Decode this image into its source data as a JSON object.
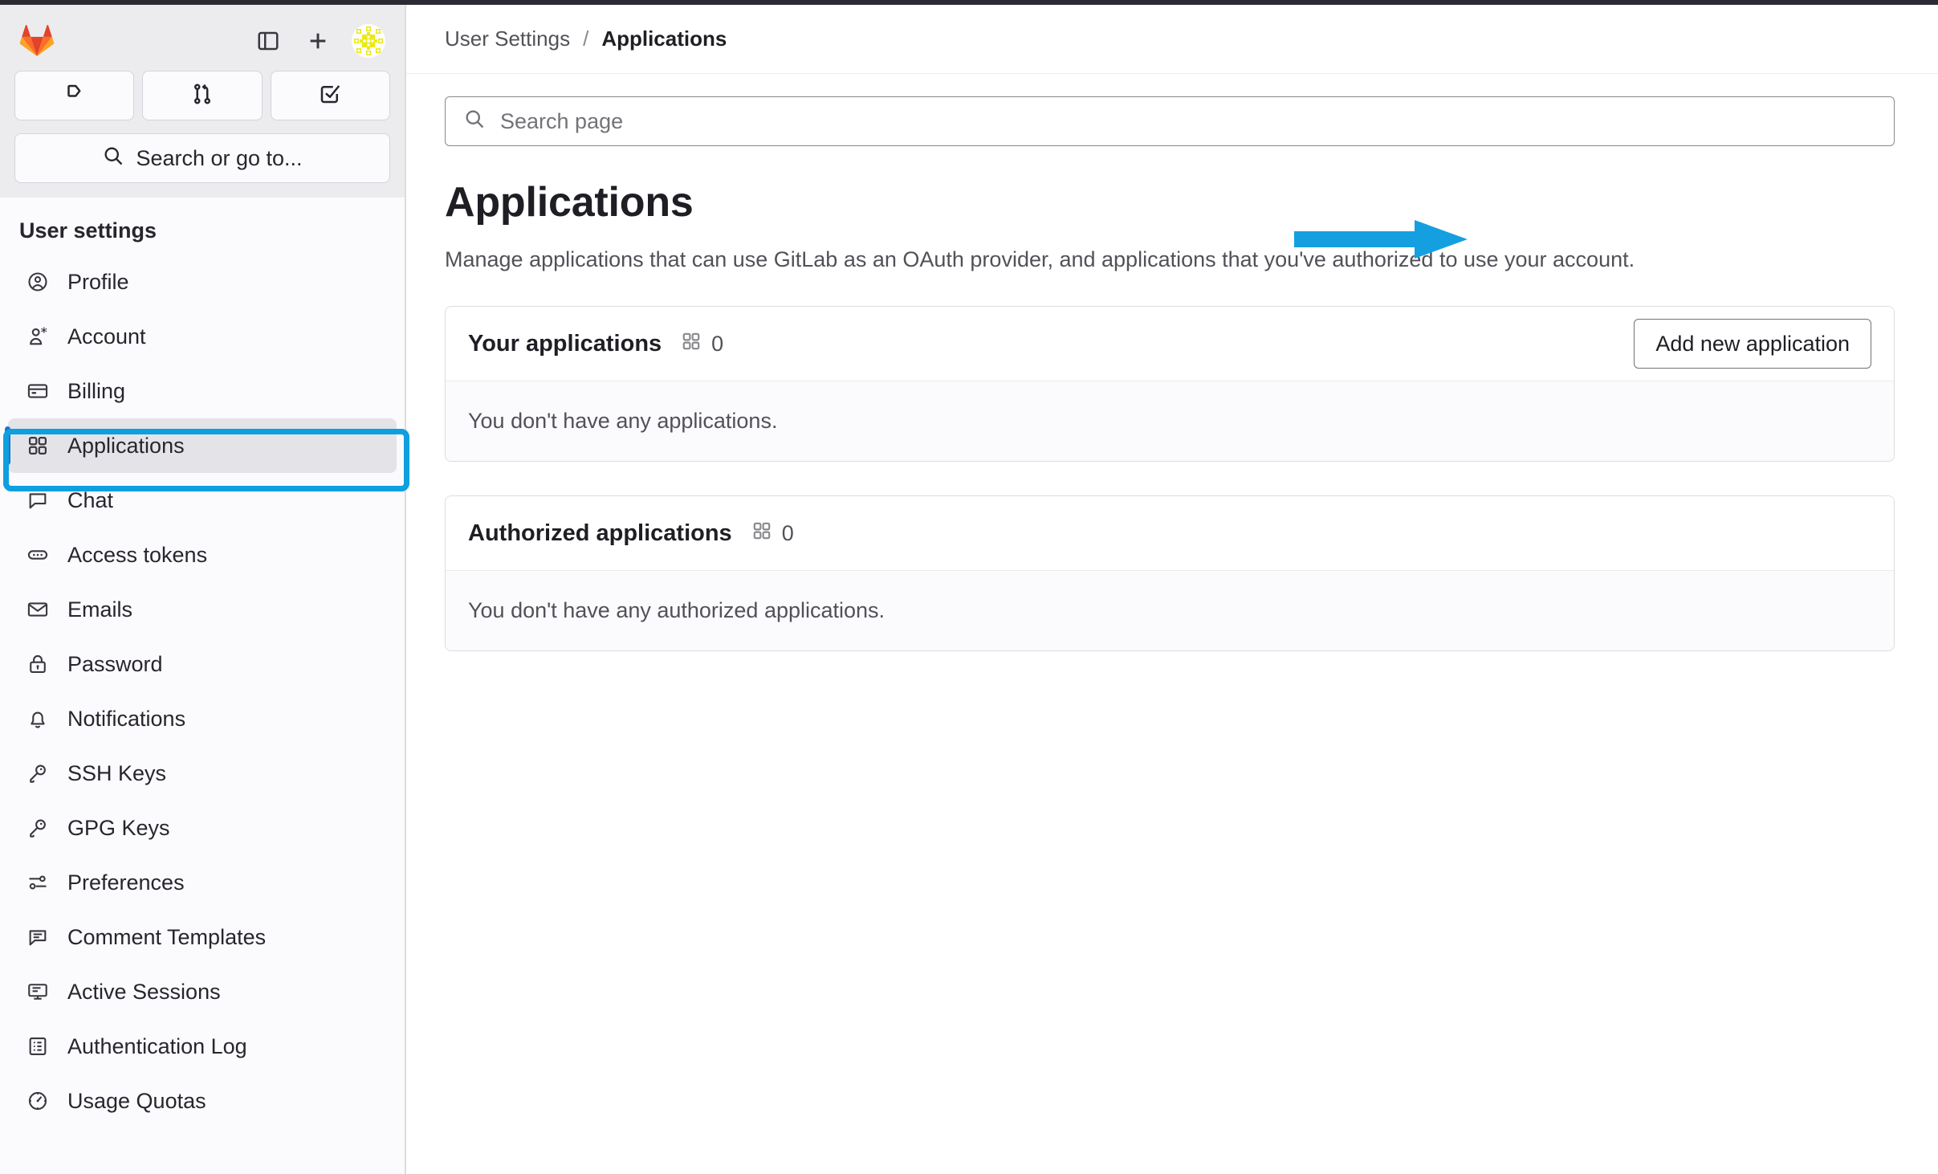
{
  "window": {
    "accent_cyan": "#0d9fe0",
    "accent_blue": "#1f75cb",
    "brand_orange": "#e24329"
  },
  "sidebar": {
    "logo_name": "gitlab-tanuki-logo",
    "header_actions": [
      {
        "name": "sidebar-toggle-icon",
        "label": "Primary navigation toggle"
      },
      {
        "name": "plus-icon",
        "label": "Create new..."
      }
    ],
    "avatar_label": "User avatar",
    "quick_actions": [
      {
        "name": "issues-icon",
        "label": "Issues"
      },
      {
        "name": "merge-requests-icon",
        "label": "Merge requests"
      },
      {
        "name": "todo-done-icon",
        "label": "To-Do List"
      }
    ],
    "search": {
      "label": "Search or go to...",
      "icon": "search-icon"
    },
    "section_title": "User settings",
    "items": [
      {
        "label": "Profile",
        "icon": "user-circle-icon",
        "active": false
      },
      {
        "label": "Account",
        "icon": "user-gear-icon",
        "active": false
      },
      {
        "label": "Billing",
        "icon": "credit-card-icon",
        "active": false
      },
      {
        "label": "Applications",
        "icon": "applications-grid-icon",
        "active": true
      },
      {
        "label": "Chat",
        "icon": "comment-icon",
        "active": false
      },
      {
        "label": "Access tokens",
        "icon": "token-icon",
        "active": false
      },
      {
        "label": "Emails",
        "icon": "envelope-icon",
        "active": false
      },
      {
        "label": "Password",
        "icon": "lock-icon",
        "active": false
      },
      {
        "label": "Notifications",
        "icon": "bell-icon",
        "active": false
      },
      {
        "label": "SSH Keys",
        "icon": "key-icon",
        "active": false
      },
      {
        "label": "GPG Keys",
        "icon": "key-icon",
        "active": false
      },
      {
        "label": "Preferences",
        "icon": "sliders-icon",
        "active": false
      },
      {
        "label": "Comment Templates",
        "icon": "comment-lines-icon",
        "active": false
      },
      {
        "label": "Active Sessions",
        "icon": "monitor-icon",
        "active": false
      },
      {
        "label": "Authentication Log",
        "icon": "list-grid-icon",
        "active": false
      },
      {
        "label": "Usage Quotas",
        "icon": "quota-gauge-icon",
        "active": false
      }
    ]
  },
  "breadcrumb": {
    "parent": "User Settings",
    "separator": "/",
    "current": "Applications"
  },
  "search": {
    "placeholder": "Search page",
    "value": "",
    "icon": "search-icon"
  },
  "main": {
    "title": "Applications",
    "description": "Manage applications that can use GitLab as an OAuth provider, and applications that you've authorized to use your account.",
    "cards": [
      {
        "title": "Your applications",
        "count": "0",
        "count_icon": "applications-grid-icon",
        "action_label": "Add new application",
        "empty_text": "You don't have any applications."
      },
      {
        "title": "Authorized applications",
        "count": "0",
        "count_icon": "applications-grid-icon",
        "action_label": "",
        "empty_text": "You don't have any authorized applications."
      }
    ]
  },
  "annotations": {
    "arrow": {
      "name": "highlight-arrow",
      "color": "#0d9fe0",
      "points_to": "Add new application"
    },
    "box": {
      "name": "highlight-box",
      "color": "#0d9fe0",
      "surrounds": "Applications"
    }
  }
}
